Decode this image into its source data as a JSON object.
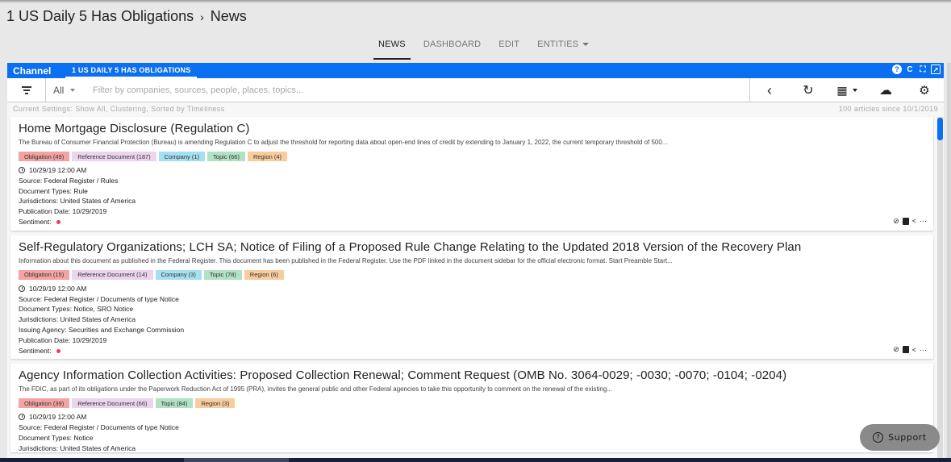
{
  "breadcrumb": {
    "parent": "1 US Daily 5 Has Obligations",
    "separator": "›",
    "current": "News"
  },
  "tabs": [
    {
      "label": "NEWS",
      "active": true
    },
    {
      "label": "DASHBOARD",
      "active": false
    },
    {
      "label": "EDIT",
      "active": false
    },
    {
      "label": "ENTITIES",
      "active": false,
      "has_dropdown": true
    }
  ],
  "channel": {
    "label": "Channel",
    "active_tab": "1 US DAILY 5 HAS OBLIGATIONS",
    "icons": [
      "help-icon",
      "refresh-icon",
      "fullscreen-icon",
      "open-external-icon"
    ],
    "icon_glyphs": {
      "help": "?",
      "refresh": "C",
      "fullscreen": "⛶",
      "external": "↗"
    }
  },
  "filter": {
    "scope_value": "All",
    "placeholder": "Filter by companies, sources, people, places, topics...",
    "tools": {
      "back": "‹",
      "history": "↻",
      "calendar": "▦",
      "download": "☁",
      "settings": "⚙"
    }
  },
  "status": {
    "settings": "Current Settings: Show All, Clustering, Sorted by Timeliness",
    "count": "100 articles since 10/1/2019"
  },
  "articles": [
    {
      "title": "Home Mortgage Disclosure (Regulation C)",
      "snippet": "The Bureau of Consumer Financial Protection (Bureau) is amending Regulation C to adjust the threshold for reporting data about open-end lines of credit by extending to January 1, 2022, the current temporary threshold of 500...",
      "badges": [
        {
          "label": "Obligation (49)",
          "type": "obl"
        },
        {
          "label": "Reference Document (187)",
          "type": "ref"
        },
        {
          "label": "Company (1)",
          "type": "com"
        },
        {
          "label": "Topic (66)",
          "type": "top"
        },
        {
          "label": "Region (4)",
          "type": "reg"
        }
      ],
      "datetime": "10/29/19 12:00 AM",
      "meta": [
        {
          "k": "Source:",
          "v": "Federal Register / Rules"
        },
        {
          "k": "Document Types:",
          "v": "Rule"
        },
        {
          "k": "Jurisdictions:",
          "v": "United States of America"
        },
        {
          "k": "Publication Date:",
          "v": "10/29/2019"
        }
      ],
      "sentiment_label": "Sentiment:",
      "sentiment_color": "#ee3a5b"
    },
    {
      "title": "Self-Regulatory Organizations; LCH SA; Notice of Filing of a Proposed Rule Change Relating to the Updated 2018 Version of the Recovery Plan",
      "snippet": "Information about this document as published in the Federal Register. This document has been published in the Federal Register. Use the PDF linked in the document sidebar for the official electronic format. Start Preamble Start...",
      "badges": [
        {
          "label": "Obligation (15)",
          "type": "obl"
        },
        {
          "label": "Reference Document (14)",
          "type": "ref"
        },
        {
          "label": "Company (3)",
          "type": "com"
        },
        {
          "label": "Topic (78)",
          "type": "top"
        },
        {
          "label": "Region (6)",
          "type": "reg"
        }
      ],
      "datetime": "10/29/19 12:00 AM",
      "meta": [
        {
          "k": "Source:",
          "v": "Federal Register / Documents of type Notice"
        },
        {
          "k": "Document Types:",
          "v": "Notice, SRO Notice"
        },
        {
          "k": "Jurisdictions:",
          "v": "United States of America"
        },
        {
          "k": "Issuing Agency:",
          "v": "Securities and Exchange Commission"
        },
        {
          "k": "Publication Date:",
          "v": "10/29/2019"
        }
      ],
      "sentiment_label": "Sentiment:",
      "sentiment_color": "#ee3a5b"
    },
    {
      "title": "Agency Information Collection Activities: Proposed Collection Renewal; Comment Request (OMB No. 3064-0029; -0030; -0070; -0104; -0204)",
      "snippet": "The FDIC, as part of its obligations under the Paperwork Reduction Act of 1995 (PRA), invites the general public and other Federal agencies to take this opportunity to comment on the renewal of the existing...",
      "badges": [
        {
          "label": "Obligation (39)",
          "type": "obl"
        },
        {
          "label": "Reference Document (66)",
          "type": "ref"
        },
        {
          "label": "Topic (84)",
          "type": "top"
        },
        {
          "label": "Region (3)",
          "type": "reg"
        }
      ],
      "datetime": "10/29/19 12:00 AM",
      "meta": [
        {
          "k": "Source:",
          "v": "Federal Register / Documents of type Notice"
        },
        {
          "k": "Document Types:",
          "v": "Notice"
        },
        {
          "k": "Jurisdictions:",
          "v": "United States of America"
        }
      ]
    }
  ],
  "card_actions": {
    "hide": "⊘",
    "save": "",
    "share": "<",
    "more": "···"
  },
  "support": {
    "label": "Support",
    "icon": "?"
  },
  "colors": {
    "accent": "#0a6ff0",
    "sentiment_negative": "#ee3a5b",
    "support_bg": "#8a8a8a"
  }
}
